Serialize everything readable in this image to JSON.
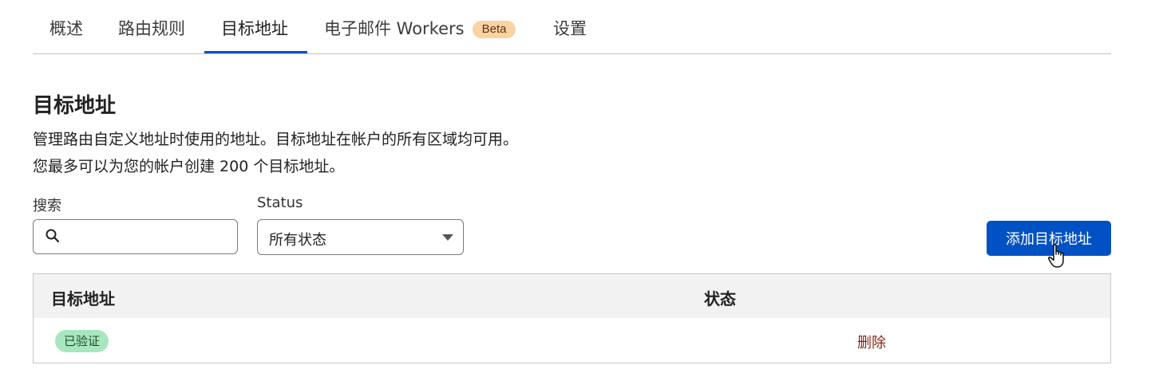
{
  "tabs": [
    {
      "label": "概述",
      "active": false
    },
    {
      "label": "路由规则",
      "active": false
    },
    {
      "label": "目标地址",
      "active": true
    },
    {
      "label": "电子邮件 Workers",
      "badge": "Beta",
      "active": false
    },
    {
      "label": "设置",
      "active": false
    }
  ],
  "page": {
    "title": "目标地址",
    "description_line1": "管理路由自定义地址时使用的地址。目标地址在帐户的所有区域均可用。",
    "description_line2": "您最多可以为您的帐户创建 200 个目标地址。"
  },
  "filters": {
    "search_label": "搜索",
    "search_value": "",
    "status_label": "Status",
    "status_value": "所有状态"
  },
  "actions": {
    "add_label": "添加目标地址"
  },
  "table": {
    "columns": [
      "目标地址",
      "状态"
    ],
    "rows": [
      {
        "address": "",
        "status": "已验证",
        "action": "删除"
      }
    ]
  },
  "colors": {
    "accent": "#0051c3",
    "beta_badge": "#fbd2a2",
    "verified_badge": "#a8e6bf",
    "delete_link": "#8a1f11"
  },
  "icons": {
    "search": "search-icon",
    "dropdown": "chevron-down-icon",
    "cursor": "hand-pointer-icon"
  }
}
